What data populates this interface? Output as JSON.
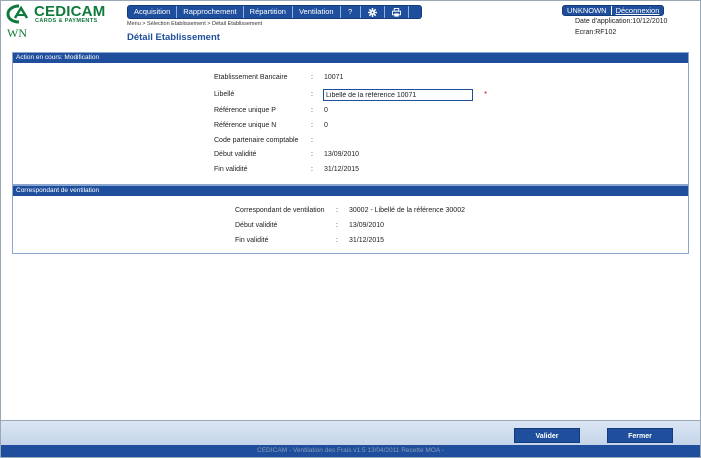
{
  "header": {
    "logo_text": "CEDICAM",
    "logo_subtitle": "CARDS & PAYMENTS",
    "app_code": "WN",
    "nav": [
      "Acquisition",
      "Rapprochement",
      "Répartition",
      "Ventilation",
      "?"
    ],
    "icons": [
      "gear-icon",
      "printer-icon"
    ],
    "breadcrumb": "Menu > Sélection Etablissement > Détail Etablissement",
    "page_title": "Détail Etablissement",
    "user": "UNKNOWN",
    "logout": "Déconnexion",
    "app_date": "Date d'application:10/12/2010",
    "screen": "Ecran:RF102"
  },
  "panel1": {
    "title": "Action en cours: Modification",
    "fields": [
      {
        "label": "Etablissement Bancaire",
        "value": "10071"
      },
      {
        "label": "Libellé",
        "value": "Libellé de la référence 10071"
      },
      {
        "label": "Référence unique P",
        "value": "0"
      },
      {
        "label": "Référence unique N",
        "value": "0"
      },
      {
        "label": "Code partenaire comptable",
        "value": ""
      },
      {
        "label": "Début validité",
        "value": "13/09/2010"
      },
      {
        "label": "Fin validité",
        "value": "31/12/2015"
      }
    ],
    "required_mark": "*"
  },
  "panel2": {
    "title": "Correspondant de ventilation",
    "fields": [
      {
        "label": "Correspondant de ventilation",
        "value": "30002 - Libellé de la référence 30002"
      },
      {
        "label": "Début validité",
        "value": "13/09/2010"
      },
      {
        "label": "Fin validité",
        "value": "31/12/2015"
      }
    ]
  },
  "footer": {
    "validate": "Valider",
    "close": "Fermer",
    "status": "CEDICAM - Ventilation des Frais v1.5 13/04/2011 Recette MOA - "
  },
  "colors": {
    "primary": "#1f4f9c",
    "brand_green": "#0f7a3b",
    "required": "#d21d1d"
  },
  "separator": ":"
}
